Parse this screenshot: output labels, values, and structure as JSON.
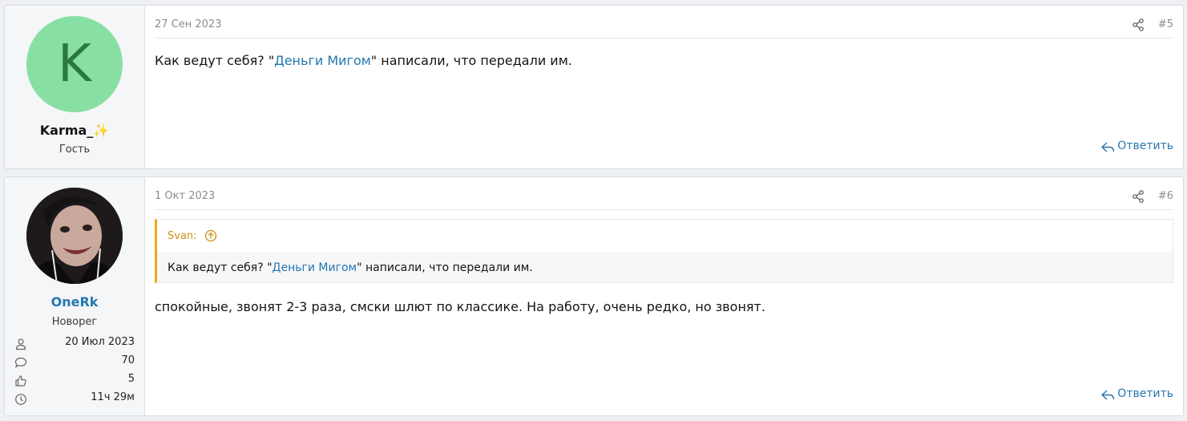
{
  "posts": [
    {
      "date": "27 Сен 2023",
      "number": "#5",
      "user": {
        "name": "Karma_",
        "emoji": "✨",
        "title": "Гость",
        "avatar_letter": "K"
      },
      "message": {
        "before": "Как ведут себя? \"",
        "link": "Деньги Мигом",
        "after": "\" написали, что передали им."
      },
      "reply_label": "Ответить"
    },
    {
      "date": "1 Окт 2023",
      "number": "#6",
      "user": {
        "name": "OneRk",
        "title": "Новорег",
        "stats": {
          "joined": "20 Июл 2023",
          "messages": "70",
          "reactions": "5",
          "time": "11ч 29м"
        }
      },
      "quote": {
        "author": "Svan:",
        "before": "Как ведут себя? \"",
        "link": "Деньги Мигом",
        "after": "\" написали, что передали им."
      },
      "message": {
        "text": "спокойные, звонят 2-3 раза, смски шлют по классике. На работу, очень редко, но звонят."
      },
      "reply_label": "Ответить"
    }
  ],
  "colors": {
    "link": "#2577b1",
    "quote_accent": "#f0a81b",
    "avatar_bg": "#88dfa3"
  },
  "icons": [
    "share-icon",
    "arrow-up-circle-icon",
    "reply-icon",
    "user-icon",
    "comment-icon",
    "thumbs-up-icon",
    "clock-icon"
  ]
}
